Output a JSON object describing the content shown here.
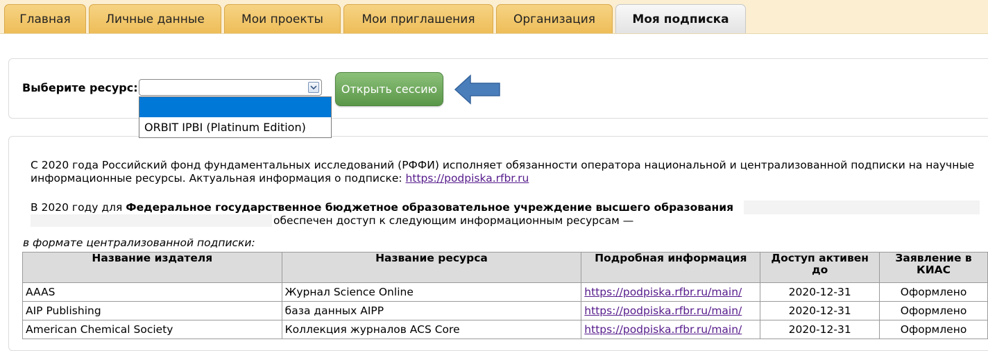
{
  "tabs": [
    {
      "label": "Главная"
    },
    {
      "label": "Личные данные"
    },
    {
      "label": "Мои проекты"
    },
    {
      "label": "Мои приглашения"
    },
    {
      "label": "Организация"
    },
    {
      "label": "Моя подписка"
    }
  ],
  "resource_form": {
    "label": "Выберите ресурс:",
    "select_value": "",
    "dropdown_options": [
      "",
      "ORBIT IPBI (Platinum Edition)"
    ],
    "open_button": "Открыть сессию"
  },
  "info": {
    "para1": "С 2020 года Российский фонд фундаментальных исследований (РФФИ) исполняет обязанности оператора национальной и централизованной подписки на научные информационные ресурсы. Актуальная информация о подписке: ",
    "para1_link": "https://podpiska.rfbr.ru",
    "para2_prefix": "В 2020 году для ",
    "para2_org": "Федеральное государственное бюджетное образовательное учреждение высшего образования",
    "para2_suffix": "обеспечен доступ к следующим информационным ресурсам —"
  },
  "format_label": "в формате централизованной подписки:",
  "table": {
    "headers": [
      "Название издателя",
      "Название ресурса",
      "Подробная информация",
      "Доступ активен до",
      "Заявление в КИАС"
    ],
    "rows": [
      [
        "AAAS",
        "Журнал Science Online",
        "https://podpiska.rfbr.ru/main/",
        "2020-12-31",
        "Оформлено"
      ],
      [
        "AIP Publishing",
        "база данных AIPP",
        "https://podpiska.rfbr.ru/main/",
        "2020-12-31",
        "Оформлено"
      ],
      [
        "American Chemical Society",
        "Коллекция журналов ACS Core",
        "https://podpiska.rfbr.ru/main/",
        "2020-12-31",
        "Оформлено"
      ]
    ]
  },
  "colors": {
    "tab_bg": "#eebd58",
    "tab_active_bg": "#e3e3e3",
    "button_green": "#5a9748",
    "arrow_blue": "#4a7ebb",
    "dropdown_highlight": "#0078d7"
  }
}
